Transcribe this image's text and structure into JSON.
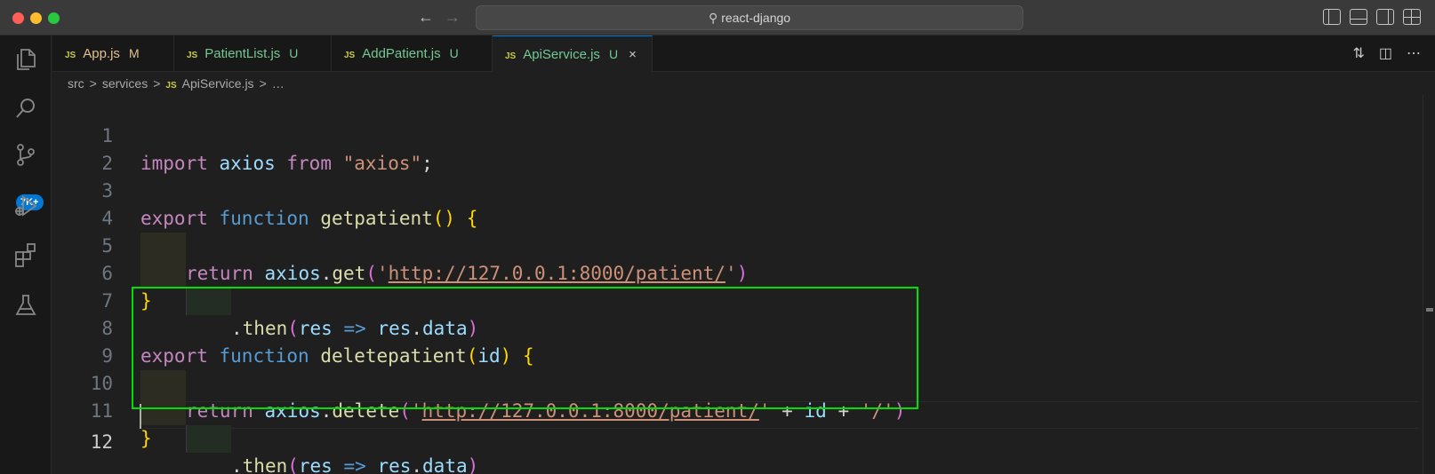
{
  "window": {
    "search_text": "react-django"
  },
  "activity_bar": {
    "items": [
      "explorer-icon",
      "search-icon",
      "source-control-icon",
      "run-debug-icon",
      "extensions-icon",
      "testing-icon"
    ],
    "source_control_badge": "7K+"
  },
  "tabs": [
    {
      "badge": "JS",
      "label": "App.js",
      "status": "M",
      "label_color": "#e2c08d",
      "status_color": "#e2c08d"
    },
    {
      "badge": "JS",
      "label": "PatientList.js",
      "status": "U",
      "label_color": "#73c991",
      "status_color": "#73c991"
    },
    {
      "badge": "JS",
      "label": "AddPatient.js",
      "status": "U",
      "label_color": "#73c991",
      "status_color": "#73c991"
    },
    {
      "badge": "JS",
      "label": "ApiService.js",
      "status": "U",
      "label_color": "#73c991",
      "status_color": "#73c991",
      "active": true
    }
  ],
  "tab_close_symbol": "×",
  "breadcrumb": {
    "parts": [
      "src",
      "services"
    ],
    "file_badge": "JS",
    "file": "ApiService.js",
    "tail": "…",
    "sep": ">"
  },
  "editor": {
    "line_numbers": [
      "1",
      "2",
      "3",
      "4",
      "5",
      "6",
      "7",
      "8",
      "9",
      "10",
      "11",
      "12"
    ],
    "tokens": {
      "import": "import",
      "axios": "axios",
      "from": "from",
      "axios_str": "\"axios\"",
      "semi": ";",
      "export": "export",
      "function": "function",
      "getpatient": "getpatient",
      "deletepatient": "deletepatient",
      "open_paren": "(",
      "close_paren": ")",
      "open_brace": "{",
      "close_brace": "}",
      "return": "return",
      "dot": ".",
      "get": "get",
      "delete": "delete",
      "quote": "'",
      "url": "http://127.0.0.1:8000/patient/",
      "then": "then",
      "res": "res",
      "arrow": "=>",
      "data": "data",
      "id": "id",
      "plus": "+",
      "slash_str": "'/'"
    }
  }
}
